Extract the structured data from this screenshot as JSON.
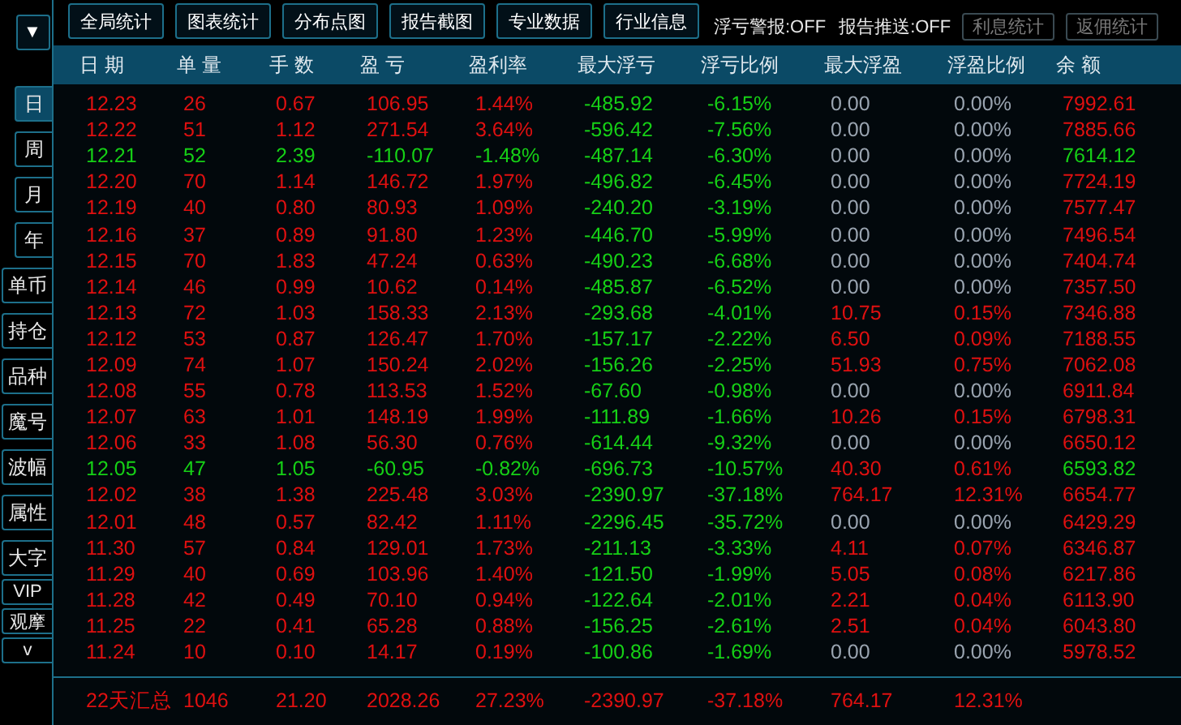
{
  "toolbar": {
    "menu_button": "▼",
    "buttons": [
      "全局统计",
      "图表统计",
      "分布点图",
      "报告截图",
      "专业数据",
      "行业信息"
    ],
    "toggles": [
      "浮亏警报:OFF",
      "报告推送:OFF"
    ],
    "side_buttons": [
      {
        "label": "利息统计",
        "disabled": true
      },
      {
        "label": "返佣统计",
        "disabled": true
      }
    ]
  },
  "sidebar": {
    "items": [
      {
        "label": "日",
        "kind": "period",
        "selected": true
      },
      {
        "label": "周",
        "kind": "period",
        "selected": false
      },
      {
        "label": "月",
        "kind": "period",
        "selected": false
      },
      {
        "label": "年",
        "kind": "period",
        "selected": false
      },
      {
        "label": "单币",
        "kind": "option",
        "selected": false
      },
      {
        "label": "持仓",
        "kind": "option",
        "selected": false
      },
      {
        "label": "品种",
        "kind": "option",
        "selected": false
      },
      {
        "label": "魔号",
        "kind": "option",
        "selected": false
      },
      {
        "label": "波幅",
        "kind": "option",
        "selected": false
      },
      {
        "label": "属性",
        "kind": "option",
        "selected": false
      },
      {
        "label": "大字",
        "kind": "option",
        "selected": false
      },
      {
        "label": "VIP",
        "kind": "compact",
        "selected": false
      },
      {
        "label": "观摩",
        "kind": "compact",
        "selected": false
      },
      {
        "label": "v",
        "kind": "compact",
        "selected": false
      }
    ]
  },
  "table": {
    "columns": [
      "日 期",
      "单 量",
      "手 数",
      "盈 亏",
      "盈利率",
      "最大浮亏",
      "浮亏比例",
      "最大浮盈",
      "浮盈比例",
      "余 额"
    ],
    "rows": [
      {
        "loss": false,
        "float_profit": false,
        "cells": [
          "12.23",
          "26",
          "0.67",
          "106.95",
          "1.44%",
          "-485.92",
          "-6.15%",
          "0.00",
          "0.00%",
          "7992.61"
        ]
      },
      {
        "loss": false,
        "float_profit": false,
        "cells": [
          "12.22",
          "51",
          "1.12",
          "271.54",
          "3.64%",
          "-596.42",
          "-7.56%",
          "0.00",
          "0.00%",
          "7885.66"
        ]
      },
      {
        "loss": true,
        "float_profit": false,
        "cells": [
          "12.21",
          "52",
          "2.39",
          "-110.07",
          "-1.48%",
          "-487.14",
          "-6.30%",
          "0.00",
          "0.00%",
          "7614.12"
        ]
      },
      {
        "loss": false,
        "float_profit": false,
        "cells": [
          "12.20",
          "70",
          "1.14",
          "146.72",
          "1.97%",
          "-496.82",
          "-6.45%",
          "0.00",
          "0.00%",
          "7724.19"
        ]
      },
      {
        "loss": false,
        "float_profit": false,
        "cells": [
          "12.19",
          "40",
          "0.80",
          "80.93",
          "1.09%",
          "-240.20",
          "-3.19%",
          "0.00",
          "0.00%",
          "7577.47"
        ]
      },
      {
        "loss": false,
        "float_profit": false,
        "cells": [
          "12.16",
          "37",
          "0.89",
          "91.80",
          "1.23%",
          "-446.70",
          "-5.99%",
          "0.00",
          "0.00%",
          "7496.54"
        ]
      },
      {
        "loss": false,
        "float_profit": false,
        "cells": [
          "12.15",
          "70",
          "1.83",
          "47.24",
          "0.63%",
          "-490.23",
          "-6.68%",
          "0.00",
          "0.00%",
          "7404.74"
        ]
      },
      {
        "loss": false,
        "float_profit": false,
        "cells": [
          "12.14",
          "46",
          "0.99",
          "10.62",
          "0.14%",
          "-485.87",
          "-6.52%",
          "0.00",
          "0.00%",
          "7357.50"
        ]
      },
      {
        "loss": false,
        "float_profit": true,
        "cells": [
          "12.13",
          "72",
          "1.03",
          "158.33",
          "2.13%",
          "-293.68",
          "-4.01%",
          "10.75",
          "0.15%",
          "7346.88"
        ]
      },
      {
        "loss": false,
        "float_profit": true,
        "cells": [
          "12.12",
          "53",
          "0.87",
          "126.47",
          "1.70%",
          "-157.17",
          "-2.22%",
          "6.50",
          "0.09%",
          "7188.55"
        ]
      },
      {
        "loss": false,
        "float_profit": true,
        "cells": [
          "12.09",
          "74",
          "1.07",
          "150.24",
          "2.02%",
          "-156.26",
          "-2.25%",
          "51.93",
          "0.75%",
          "7062.08"
        ]
      },
      {
        "loss": false,
        "float_profit": false,
        "cells": [
          "12.08",
          "55",
          "0.78",
          "113.53",
          "1.52%",
          "-67.60",
          "-0.98%",
          "0.00",
          "0.00%",
          "6911.84"
        ]
      },
      {
        "loss": false,
        "float_profit": true,
        "cells": [
          "12.07",
          "63",
          "1.01",
          "148.19",
          "1.99%",
          "-111.89",
          "-1.66%",
          "10.26",
          "0.15%",
          "6798.31"
        ]
      },
      {
        "loss": false,
        "float_profit": false,
        "cells": [
          "12.06",
          "33",
          "1.08",
          "56.30",
          "0.76%",
          "-614.44",
          "-9.32%",
          "0.00",
          "0.00%",
          "6650.12"
        ]
      },
      {
        "loss": true,
        "float_profit": true,
        "cells": [
          "12.05",
          "47",
          "1.05",
          "-60.95",
          "-0.82%",
          "-696.73",
          "-10.57%",
          "40.30",
          "0.61%",
          "6593.82"
        ]
      },
      {
        "loss": false,
        "float_profit": true,
        "cells": [
          "12.02",
          "38",
          "1.38",
          "225.48",
          "3.03%",
          "-2390.97",
          "-37.18%",
          "764.17",
          "12.31%",
          "6654.77"
        ]
      },
      {
        "loss": false,
        "float_profit": false,
        "cells": [
          "12.01",
          "48",
          "0.57",
          "82.42",
          "1.11%",
          "-2296.45",
          "-35.72%",
          "0.00",
          "0.00%",
          "6429.29"
        ]
      },
      {
        "loss": false,
        "float_profit": true,
        "cells": [
          "11.30",
          "57",
          "0.84",
          "129.01",
          "1.73%",
          "-211.13",
          "-3.33%",
          "4.11",
          "0.07%",
          "6346.87"
        ]
      },
      {
        "loss": false,
        "float_profit": true,
        "cells": [
          "11.29",
          "40",
          "0.69",
          "103.96",
          "1.40%",
          "-121.50",
          "-1.99%",
          "5.05",
          "0.08%",
          "6217.86"
        ]
      },
      {
        "loss": false,
        "float_profit": true,
        "cells": [
          "11.28",
          "42",
          "0.49",
          "70.10",
          "0.94%",
          "-122.64",
          "-2.01%",
          "2.21",
          "0.04%",
          "6113.90"
        ]
      },
      {
        "loss": false,
        "float_profit": true,
        "cells": [
          "11.25",
          "22",
          "0.41",
          "65.28",
          "0.88%",
          "-156.25",
          "-2.61%",
          "2.51",
          "0.04%",
          "6043.80"
        ]
      },
      {
        "loss": false,
        "float_profit": false,
        "cells": [
          "11.24",
          "10",
          "0.10",
          "14.17",
          "0.19%",
          "-100.86",
          "-1.69%",
          "0.00",
          "0.00%",
          "5978.52"
        ]
      }
    ],
    "total": [
      "22天汇总",
      "1046",
      "21.20",
      "2028.26",
      "27.23%",
      "-2390.97",
      "-37.18%",
      "764.17",
      "12.31%"
    ]
  }
}
